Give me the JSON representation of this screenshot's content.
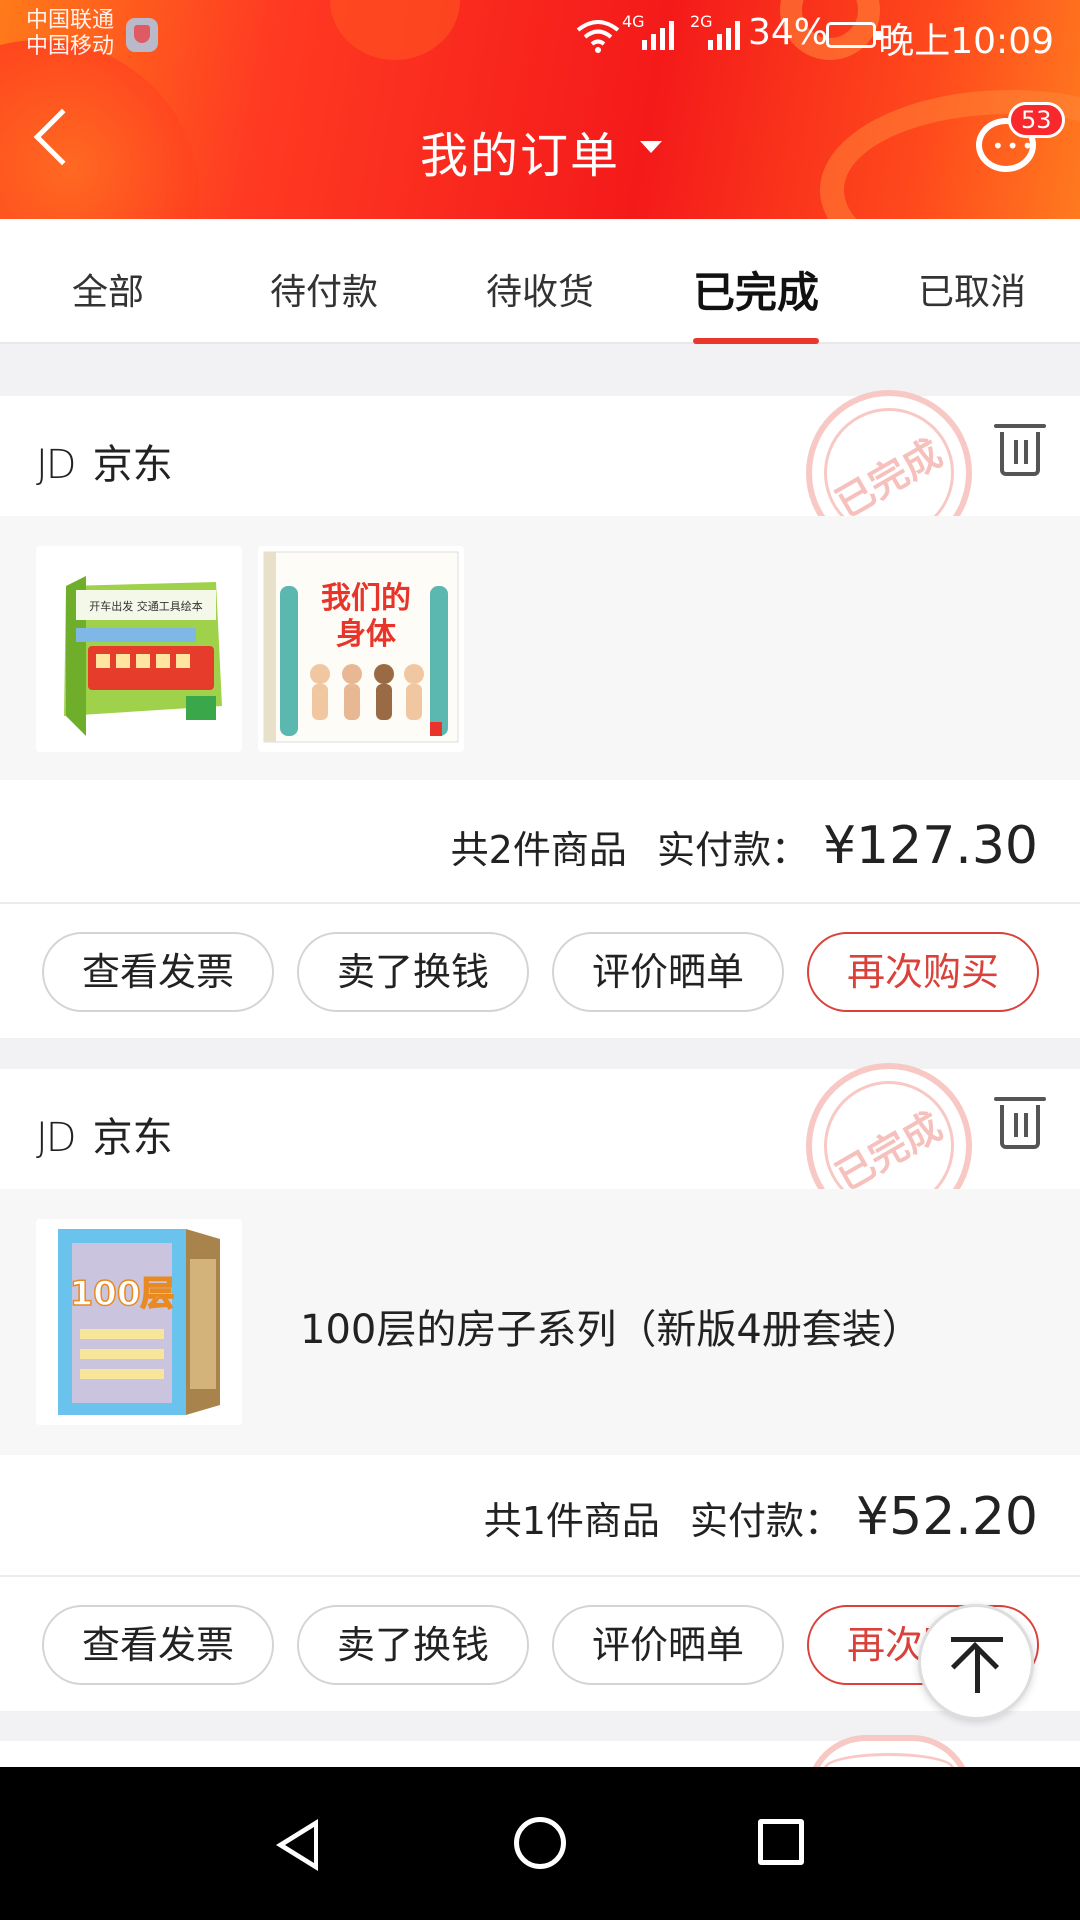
{
  "status_bar": {
    "carrier1": "中国联通",
    "carrier2": "中国移动",
    "net1": "4G",
    "net2": "2G",
    "battery": "34%",
    "time": "晚上10:09"
  },
  "header": {
    "title": "我的订单",
    "message_badge": "53",
    "colors": {
      "primary": "#f41a1a",
      "accent_orange": "#ff7a1a"
    }
  },
  "tabs": [
    {
      "label": "全部"
    },
    {
      "label": "待付款"
    },
    {
      "label": "待收货"
    },
    {
      "label": "已完成",
      "active": true
    },
    {
      "label": "已取消"
    }
  ],
  "orders": [
    {
      "shop_logo": "JD",
      "shop_name": "京东",
      "stamp": "已完成",
      "products": [
        {
          "image_text": "开车出发 交通工具绘本"
        },
        {
          "image_text": "我们的身体"
        }
      ],
      "count_text": "共2件商品",
      "paid_label": "实付款：",
      "price": "¥127.30",
      "buttons": [
        "查看发票",
        "卖了换钱",
        "评价晒单",
        "再次购买"
      ]
    },
    {
      "shop_logo": "JD",
      "shop_name": "京东",
      "stamp": "已完成",
      "product_name": "100层的房子系列（新版4册套装）",
      "product_image_text": "100层",
      "count_text": "共1件商品",
      "paid_label": "实付款：",
      "price": "¥52.20",
      "buttons": [
        "查看发票",
        "卖了换钱",
        "评价晒单",
        "再次购买"
      ]
    }
  ]
}
